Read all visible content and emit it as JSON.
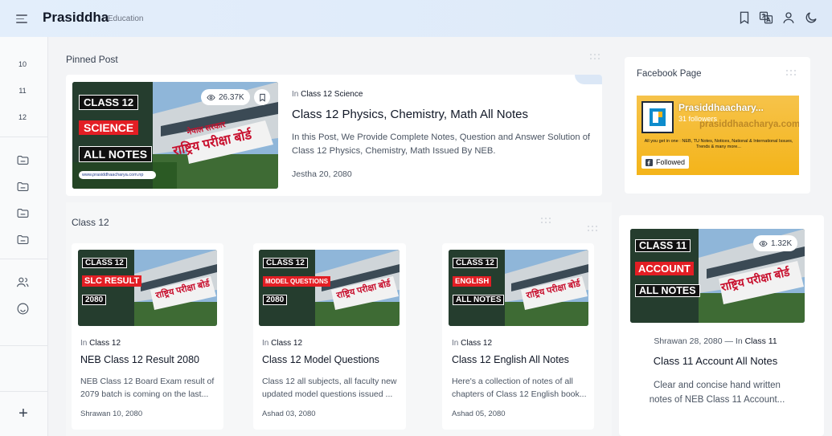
{
  "header": {
    "brand": "Prasiddha",
    "brand_sub": "Education"
  },
  "rail": {
    "items": [
      "10",
      "11",
      "12"
    ]
  },
  "pinned": {
    "section_title": "Pinned Post",
    "category_prefix": "In",
    "category": "Class 12 Science",
    "title": "Class 12 Physics, Chemistry, Math All Notes",
    "excerpt": "In this Post, We Provide Complete Notes, Question and Answer Solution of Class 12 Physics, Chemistry, Math Issued By NEB.",
    "date": "Jestha 20, 2080",
    "views": "26.37K",
    "thumb": {
      "line1": "CLASS 12",
      "line2": "SCIENCE",
      "line3": "ALL NOTES",
      "banner1": "नेपाल सरकार",
      "banner2": "राष्ट्रिय परीक्षा बोर्ड",
      "site": "www.prasiddhaacharya.com.np"
    }
  },
  "class12": {
    "section_title": "Class 12",
    "posts": [
      {
        "category_prefix": "In",
        "category": "Class 12",
        "title": "NEB Class 12 Result 2080",
        "excerpt": "NEB Class 12 Board Exam result of 2079 batch is coming on the last...",
        "date": "Shrawan 10, 2080",
        "thumb": {
          "line1": "CLASS 12",
          "line2": "SLC RESULT",
          "line3": "2080"
        }
      },
      {
        "category_prefix": "In",
        "category": "Class 12",
        "title": "Class 12 Model Questions",
        "excerpt": "Class 12 all subjects, all faculty new updated model questions issued ...",
        "date": "Ashad 03, 2080",
        "thumb": {
          "line1": "CLASS 12",
          "line2": "MODEL QUESTIONS",
          "line3": "2080"
        }
      },
      {
        "category_prefix": "In",
        "category": "Class 12",
        "title": "Class 12 English All Notes",
        "excerpt": "Here's a collection of notes of all chapters of Class 12 English book...",
        "date": "Ashad 05, 2080",
        "thumb": {
          "line1": "CLASS 12",
          "line2": "ENGLISH",
          "line3": "ALL NOTES"
        }
      }
    ]
  },
  "facebook": {
    "section_title": "Facebook Page",
    "page_name": "Prasiddhaachary...",
    "followers": "31 followers",
    "site": "prasiddhaacharya.com.np",
    "tagline": "All you get in one : NEB, TU Notes, Notices, National & International Issues, Trends & many more...",
    "followed_label": "Followed"
  },
  "side_post": {
    "views": "1.32K",
    "date": "Shrawan 28, 2080",
    "separator": "—",
    "category_prefix": "In",
    "category": "Class 11",
    "title": "Class 11 Account All Notes",
    "excerpt": "Clear and concise hand written notes of NEB Class 11 Account...",
    "thumb": {
      "line1": "CLASS 11",
      "line2": "ACCOUNT",
      "line3": "ALL NOTES"
    }
  },
  "colors": {
    "header_bg": "#dde9f8",
    "accent_red": "#e31e24",
    "accent_blue": "#2563eb"
  }
}
